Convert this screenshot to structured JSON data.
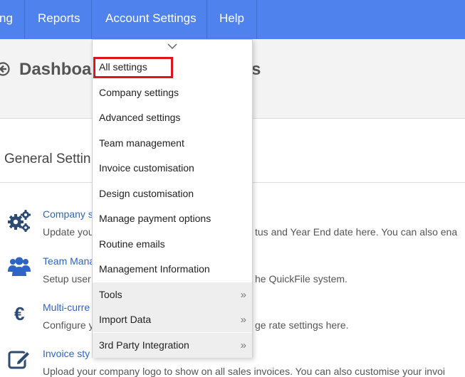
{
  "navbar": {
    "items": [
      "ng",
      "Reports",
      "Account Settings",
      "Help"
    ],
    "bg_color": "#4f82ec"
  },
  "header": {
    "title": "Dashboa",
    "title_tail": "s"
  },
  "general": {
    "title": "General Settin",
    "rows": [
      {
        "icon": "gears-icon",
        "title": "Company s",
        "desc": "Update you",
        "desc_tail": "tus and Year End date here. You can also ena"
      },
      {
        "icon": "users-icon",
        "title": "Team Mana",
        "desc": "Setup user",
        "desc_tail": "he QuickFile system."
      },
      {
        "icon": "euro-icon",
        "title": "Multi-curre",
        "desc": "Configure y",
        "desc_tail": "ge rate settings here."
      },
      {
        "icon": "edit-icon",
        "title": "Invoice sty",
        "desc": "Upload your company logo to show on all sales invoices. You can also customise your invoi",
        "desc_tail": ""
      }
    ]
  },
  "dropdown": {
    "items": [
      {
        "label": "All settings",
        "has_submenu": false,
        "highlighted": true
      },
      {
        "label": "Company settings",
        "has_submenu": false
      },
      {
        "label": "Advanced settings",
        "has_submenu": false
      },
      {
        "label": "Team management",
        "has_submenu": false
      },
      {
        "label": "Invoice customisation",
        "has_submenu": false
      },
      {
        "label": "Design customisation",
        "has_submenu": false
      },
      {
        "label": "Manage payment options",
        "has_submenu": false
      },
      {
        "label": "Routine emails",
        "has_submenu": false
      },
      {
        "label": "Management Information",
        "has_submenu": false
      },
      {
        "label": "Tools",
        "has_submenu": true
      },
      {
        "label": "Import Data",
        "has_submenu": true
      },
      {
        "label": "3rd Party Integration",
        "has_submenu": true
      }
    ],
    "submenu_arrow": "»",
    "highlight_color": "#e0141c"
  }
}
